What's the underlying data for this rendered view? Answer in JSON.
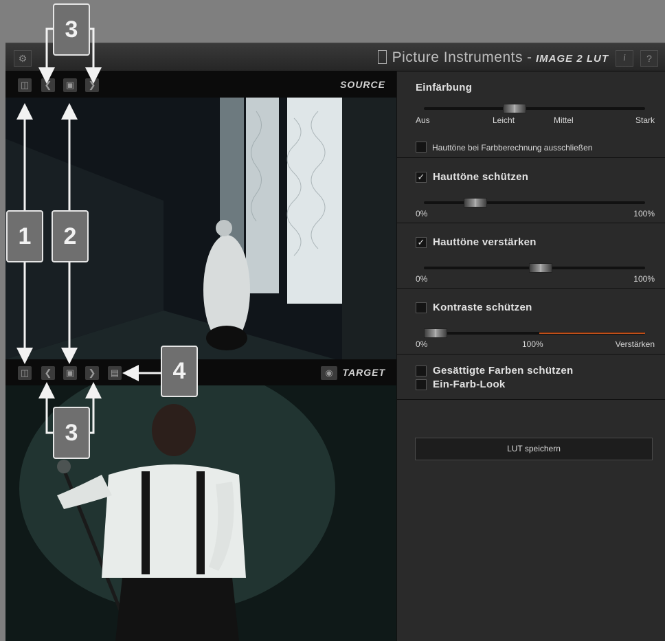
{
  "window": {
    "brand": "Picture Instruments",
    "separator": "-",
    "product": "IMAGE 2 LUT",
    "info_button": "i",
    "help_button": "?",
    "settings_icon": "gear-icon"
  },
  "source": {
    "label": "SOURCE",
    "buttons": [
      "bag-icon",
      "chevron-left-icon",
      "folder-icon",
      "chevron-right-icon"
    ]
  },
  "target": {
    "label": "TARGET",
    "buttons": [
      "bag-icon",
      "chevron-left-icon",
      "folder-icon",
      "chevron-right-icon",
      "save-icon",
      "eye-icon"
    ]
  },
  "panel": {
    "colorize": {
      "title": "Einfärbung",
      "ticks": [
        "Aus",
        "Leicht",
        "Mittel",
        "Stark"
      ],
      "value": 0.4,
      "exclude_skin_label": "Hauttöne bei Farbberechnung ausschließen",
      "exclude_skin_checked": false
    },
    "protect_skin": {
      "title": "Hauttöne schützen",
      "checked": true,
      "min": "0%",
      "max": "100%",
      "value": 0.2
    },
    "enhance_skin": {
      "title": "Hauttöne verstärken",
      "checked": true,
      "min": "0%",
      "max": "100%",
      "value": 0.53
    },
    "protect_contrast": {
      "title": "Kontraste schützen",
      "checked": false,
      "ticks": [
        "0%",
        "100%",
        "Verstärken"
      ],
      "value": 0.0
    },
    "protect_saturated": {
      "title": "Gesättigte Farben schützen",
      "checked": false
    },
    "single_color": {
      "title": "Ein-Farb-Look",
      "checked": false
    },
    "save_lut": "LUT speichern"
  },
  "callouts": [
    "3",
    "1",
    "2",
    "4",
    "3"
  ],
  "colors": {
    "accent_orange": "#c0501a",
    "background": "#2a2a2a",
    "strip": "#0b0b0b"
  }
}
